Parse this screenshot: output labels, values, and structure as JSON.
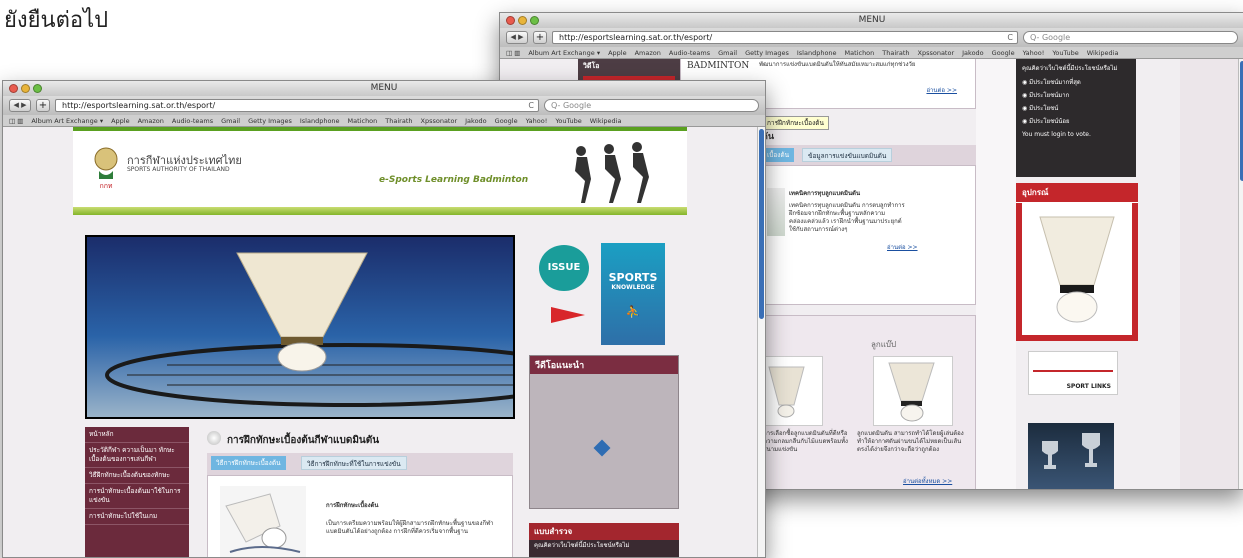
{
  "caption": "ยังยืนต่อไป",
  "back": {
    "title": "MENU",
    "url": "http://esportslearning.sat.or.th/esport/",
    "url_reload": "C",
    "search": "Q- Google",
    "bookmarks": [
      "Album Art Exchange ▾",
      "Apple",
      "Amazon",
      "Audio-teams",
      "Gmail",
      "Getty Images",
      "Islandphone",
      "Matichon",
      "Thairath",
      "Xpssonator",
      "Jakodo",
      "Google",
      "Yahoo!",
      "YouTube",
      "Wikipedia"
    ],
    "side_head": "วิดีโอ",
    "badminton": "BADMINTON",
    "intro": "พัฒนาการแข่งขันแบดมินตันให้ทันสมัยเหมาะสมแก่ทุกช่วงวัย",
    "more1": "อ่านต่อ >>",
    "tooltip": "การฝึกทักษะเบื้องต้น",
    "section_mark": "ดัน",
    "tabs": [
      "เบื้องต้น",
      "ข้อมูลการแข่งขันแบดมินตัน"
    ],
    "card_title": "เทคนิคการทุบลูกแบดมินตัน",
    "card_text": "เทคนิคการทุบลูกแบดมินตัน การตบลูกทำการฝึกซ้อมจากฝึกทักษะพื้นฐานหลักความคล่องแคล่วแล้ว เราฝึกนำพื้นฐานมาประยุกต์ใช้กับสถานการณ์ต่างๆ",
    "more2": "อ่านต่อ >>",
    "shuttle_title": "ลูกแบ๊ป",
    "shuttle_text": "ลูกแบดมินตัน สามารถทำได้โดยผู้เล่นต้องทำให้อากาศดันผ่านขนได้ไม่หยดเป็นเส้นตรงได้ง่ายจึงกว่าจะถือว่าถูกต้อง",
    "shuttle_more": "อ่านต่อทั้งหมด >>",
    "shuttle_left_text": "การเลือกซื้อลูกแบดมินตันที่ดีหรือความกลมกลืนกับไม้แบดพร้อมทั้งสนามแข่งขัน",
    "poll_title": "คุณคิดว่าเว็บไซต์นี้มีประโยชน์หรือไม่",
    "poll_options": [
      "มีประโยชน์มากที่สุด",
      "มีประโยชน์มาก",
      "มีประโยชน์",
      "มีประโยชน์น้อย"
    ],
    "poll_login": "You must login to vote.",
    "equipment": "อุปกรณ์",
    "sport_label": "SPORT LINKS"
  },
  "front": {
    "title": "MENU",
    "url": "http://esportslearning.sat.or.th/esport/",
    "url_reload": "C",
    "search": "Q- Google",
    "bookmarks": [
      "Album Art Exchange ▾",
      "Apple",
      "Amazon",
      "Audio-teams",
      "Gmail",
      "Getty Images",
      "Islandphone",
      "Matichon",
      "Thairath",
      "Xpssonator",
      "Jakodo",
      "Google",
      "Yahoo!",
      "YouTube",
      "Wikipedia"
    ],
    "org_th": "การกีฬาแห่งประเทศไทย",
    "org_en": "SPORTS AUTHORITY OF THAILAND",
    "org_abbr": "กกท",
    "banner_title": "e-Sports Learning Badminton",
    "issue": "ISSUE",
    "sports_knowledge_1": "SPORTS",
    "sports_knowledge_2": "KNOWLEDGE",
    "video_head": "วีดีโอแนะนำ",
    "menu": [
      "หน้าหลัก",
      "ประวัติกีฬา ความเป็นมา ทักษะเบื้องต้นของการเล่นกีฬา",
      "วิธีฝึกทักษะเบื้องต้นของทักษะ",
      "การนำทักษะเบื้องต้นมาใช้ในการแข่งขัน",
      "การนำทักษะไปใช้ในเกม"
    ],
    "section_title": "การฝึกทักษะเบื้องต้นกีฬาแบดมินตัน",
    "tabs": [
      "วิธีการฝึกทักษะเบื้องต้น",
      "วิธีการฝึกทักษะที่ใช้ในการแข่งขัน"
    ],
    "article_title": "การฝึกทักษะเบื้องต้น",
    "article_text": "เป็นการเตรียมความพร้อมให้ผู้ฝึกสามารถฝึกทักษะพื้นฐานของกีฬาแบดมินตันได้อย่างถูกต้อง การฝึกที่ดีควรเริ่มจากพื้นฐาน",
    "survey_head": "แบบสำรวจ",
    "survey_q": "คุณคิดว่าเว็บไซต์นี้มีประโยชน์หรือไม่"
  },
  "colors": {
    "accent": "#5aa020",
    "maroon": "#6b2a3c",
    "red": "#c4262b",
    "tab": "#6fb6e1"
  }
}
